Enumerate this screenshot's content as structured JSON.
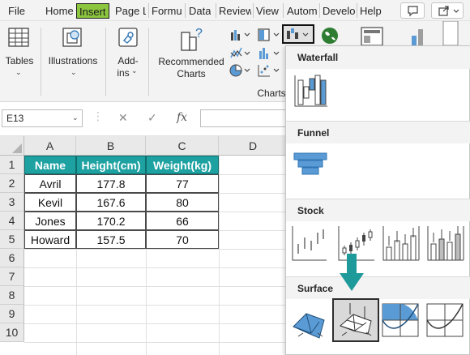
{
  "ribbon_tabs": [
    "File",
    "Home",
    "Insert",
    "Page L",
    "Formu",
    "Data",
    "Review",
    "View",
    "Autom",
    "Develo",
    "Help"
  ],
  "active_tab": "Insert",
  "ribbon": {
    "tables_label": "Tables",
    "illustrations_label": "Illustrations",
    "addins_label_1": "Add-",
    "addins_label_2": "ins",
    "recommended_label_1": "Recommended",
    "recommended_label_2": "Charts",
    "charts_group_label": "Charts"
  },
  "formula_bar": {
    "name_box": "E13",
    "cancel_symbol": "✕",
    "enter_symbol": "✓",
    "fx_symbol": "fx",
    "value": ""
  },
  "sheet": {
    "columns": [
      "A",
      "B",
      "C",
      "D"
    ],
    "rows": [
      "1",
      "2",
      "3",
      "4",
      "5",
      "6",
      "7",
      "8",
      "9",
      "10"
    ],
    "headers": [
      "Name",
      "Height(cm)",
      "Weight(kg)"
    ],
    "data": [
      [
        "Avril",
        "177.8",
        "77"
      ],
      [
        "Kevil",
        "167.6",
        "80"
      ],
      [
        "Jones",
        "170.2",
        "66"
      ],
      [
        "Howard",
        "157.5",
        "70"
      ]
    ]
  },
  "chart_menu": {
    "sections": [
      "Waterfall",
      "Funnel",
      "Stock",
      "Surface"
    ],
    "selected_chart": "Wireframe 3-D Surface"
  },
  "colors": {
    "active_tab": "#8cc63f",
    "table_header": "#1ea1a1",
    "arrow": "#1f9a9a",
    "chart_blue": "#5b9bd5"
  }
}
